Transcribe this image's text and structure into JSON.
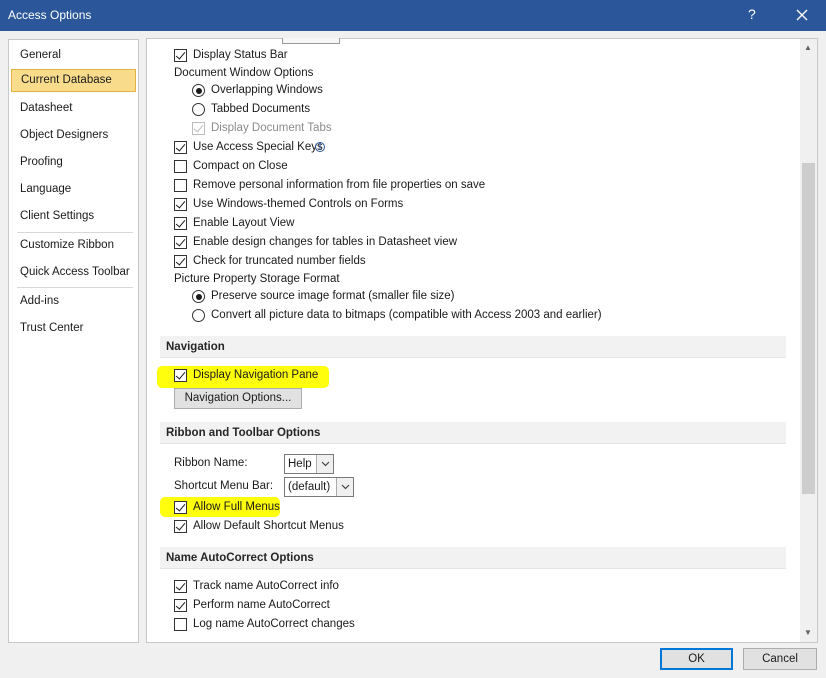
{
  "window": {
    "title": "Access Options",
    "help": "?",
    "close_icon": "close-icon"
  },
  "sidebar": {
    "items": [
      {
        "label": "General"
      },
      {
        "label": "Current Database",
        "selected": true
      },
      {
        "label": "Datasheet"
      },
      {
        "label": "Object Designers"
      },
      {
        "label": "Proofing"
      },
      {
        "label": "Language"
      },
      {
        "label": "Client Settings"
      },
      {
        "label": "Customize Ribbon"
      },
      {
        "label": "Quick Access Toolbar"
      },
      {
        "label": "Add-ins"
      },
      {
        "label": "Trust Center"
      }
    ]
  },
  "app_options": {
    "display_status_bar": {
      "label": "Display Status Bar",
      "checked": true
    },
    "document_window_options": {
      "label": "Document Window Options"
    },
    "overlapping_windows": {
      "label": "Overlapping Windows",
      "selected": true
    },
    "tabbed_documents": {
      "label": "Tabbed Documents",
      "selected": false
    },
    "display_document_tabs": {
      "label": "Display Document Tabs",
      "checked": true,
      "disabled": true
    },
    "use_access_special_keys": {
      "label": "Use Access Special Keys",
      "checked": true,
      "info_icon": "info-icon"
    },
    "compact_on_close": {
      "label": "Compact on Close",
      "checked": false
    },
    "remove_personal_info": {
      "label": "Remove personal information from file properties on save",
      "checked": false
    },
    "windows_themed_controls": {
      "label": "Use Windows-themed Controls on Forms",
      "checked": true
    },
    "enable_layout_view": {
      "label": "Enable Layout View",
      "checked": true
    },
    "enable_design_changes": {
      "label": "Enable design changes for tables in Datasheet view",
      "checked": true
    },
    "check_truncated": {
      "label": "Check for truncated number fields",
      "checked": true
    },
    "picture_property": {
      "label": "Picture Property Storage Format"
    },
    "preserve_source": {
      "label": "Preserve source image format (smaller file size)",
      "selected": true
    },
    "convert_bitmaps": {
      "label": "Convert all picture data to bitmaps (compatible with Access 2003 and earlier)",
      "selected": false
    }
  },
  "navigation": {
    "header": "Navigation",
    "display_nav_pane": {
      "label": "Display Navigation Pane",
      "checked": true
    },
    "nav_options_button": "Navigation Options..."
  },
  "ribbon": {
    "header": "Ribbon and Toolbar Options",
    "ribbon_name_label": "Ribbon Name:",
    "ribbon_name_value": "Help",
    "shortcut_menu_label": "Shortcut Menu Bar:",
    "shortcut_menu_value": "(default)",
    "allow_full_menus": {
      "label": "Allow Full Menus",
      "checked": true
    },
    "allow_default_shortcut": {
      "label": "Allow Default Shortcut Menus",
      "checked": true
    }
  },
  "autocorrect": {
    "header": "Name AutoCorrect Options",
    "track_name": {
      "label": "Track name AutoCorrect info",
      "checked": true
    },
    "perform_name": {
      "label": "Perform name AutoCorrect",
      "checked": true
    },
    "log_name": {
      "label": "Log name AutoCorrect changes",
      "checked": false
    }
  },
  "footer": {
    "ok": "OK",
    "cancel": "Cancel"
  },
  "colors": {
    "titlebar": "#2b579a",
    "selected_nav": "#f8dc8c",
    "highlight": "#ffff00",
    "primary_border": "#0078d7"
  }
}
